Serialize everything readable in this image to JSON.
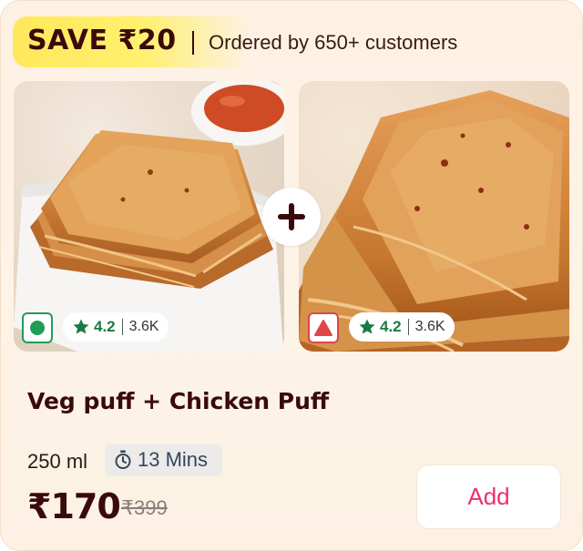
{
  "header": {
    "save_label": "SAVE ₹20",
    "ordered_text": "Ordered by 650+ customers"
  },
  "items": [
    {
      "diet": "veg",
      "rating": "4.2",
      "rating_count": "3.6K"
    },
    {
      "diet": "non-veg",
      "rating": "4.2",
      "rating_count": "3.6K"
    }
  ],
  "plus_symbol": "+",
  "product": {
    "title": "Veg puff + Chicken Puff",
    "quantity": "250 ml",
    "delivery_time": "13 Mins",
    "price": "₹170",
    "mrp": "₹399",
    "add_label": "Add"
  },
  "colors": {
    "save_highlight": "#ffe85c",
    "veg": "#1f9d55",
    "non_veg": "#e0454a",
    "rating_green": "#1b7a43",
    "add_pink": "#e8336b",
    "text_brown": "#3a0a0a"
  },
  "icons": {
    "veg_indicator": "veg-dot-icon",
    "nonveg_indicator": "nonveg-triangle-icon",
    "rating": "star-icon",
    "timer": "stopwatch-icon",
    "combo": "plus-icon"
  }
}
